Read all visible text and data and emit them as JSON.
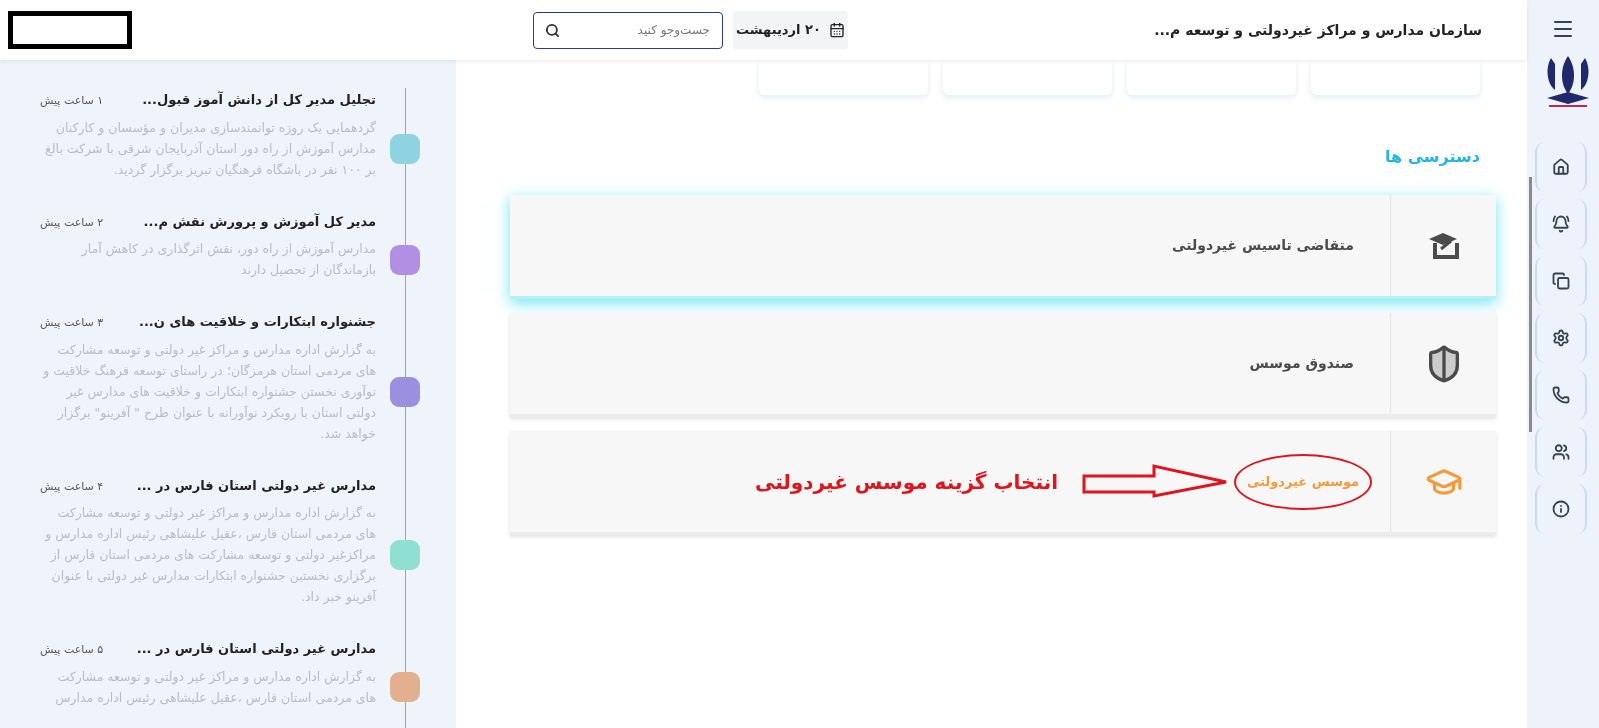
{
  "header": {
    "title": "سازمان مدارس و مراکز غیردولتی و توسعه م...",
    "date": "۲۰ اردیبهشت",
    "search": {
      "placeholder": "جست‌وجو کنید"
    }
  },
  "sidebar": {
    "items": [
      {
        "kind": "home"
      },
      {
        "kind": "bell"
      },
      {
        "kind": "bookmarks"
      },
      {
        "kind": "settings"
      },
      {
        "kind": "phone"
      },
      {
        "kind": "users"
      },
      {
        "kind": "info"
      }
    ]
  },
  "access": {
    "title": "دسترسی ها",
    "items": [
      {
        "label": "متقاضی تاسیس غیردولتی",
        "kind": "board",
        "highlighted": true,
        "selected": false
      },
      {
        "label": "صندوق موسس",
        "kind": "shield",
        "highlighted": false,
        "selected": false
      },
      {
        "label": "موسس غیردولتی",
        "kind": "cap",
        "highlighted": false,
        "selected": true,
        "annotation": "انتخاب گزینه موسس غیردولتی"
      }
    ]
  },
  "news": [
    {
      "title": "تجلیل مدیر کل از دانش آموز قبول...",
      "time": "۱ ساعت پیش",
      "body": "گردهمایی یک روزه توانمندسازی مدیران و مؤسسان و کارکنان مدارس آموزش از راه دور استان آذربایجان شرقی با شرکت بالغ بر ۱۰۰ نفر در باشگاه فرهنگیان تبریز برگزار گردید.",
      "color": "#8fd3e0"
    },
    {
      "title": "مدیر کل آموزش و پرورش نقش م...",
      "time": "۲ ساعت پیش",
      "body": "مدارس آموزش از راه دور، نقش اثرگذاری در کاهش آمار بازماندگان از تحصیل دارند",
      "color": "#b28fe2"
    },
    {
      "title": "جشنواره ابتکارات و خلاقیت های ن...",
      "time": "۳ ساعت پیش",
      "body": "به گزارش اداره مدارس و مراکز غیر دولتی و توسعه مشارکت های مردمی استان هرمزگان؛ در راستای توسعه فرهنگ خلاقیت و نوآوری نخستن جشنواره ابتکارات و خلاقیت های مدارس غیر دولتی استان با رویکرد نوآورانه با عنوان طرح \" آفرینو\" برگزار خواهد شد.",
      "color": "#9b8fe0"
    },
    {
      "title": "مدارس غیر دولتی استان فارس در ...",
      "time": "۴ ساعت پیش",
      "body": "به گزارش اداره مدارس و مراکز غیر دولتی و توسعه مشارکت های مردمی استان فارس ،عقیل علیشاهی رئیس اداره مدارس و مراکزغیر دولتی و توسعه مشارکت های مردمی استان فارس از برگزاری نخستین جشنواره ابتکارات مدارس غیر دولتی با عنوان آفرینو خبر داد.",
      "color": "#8fe0d3"
    },
    {
      "title": "مدارس غیر دولتی استان فارس در ...",
      "time": "۵ ساعت پیش",
      "body": "به گزارش اداره مدارس و مراکز غیر دولتی و توسعه مشارکت های مردمی استان فارس ،عقیل علیشاهی رئیس اداره مدارس",
      "color": "#e3b08f"
    }
  ]
}
